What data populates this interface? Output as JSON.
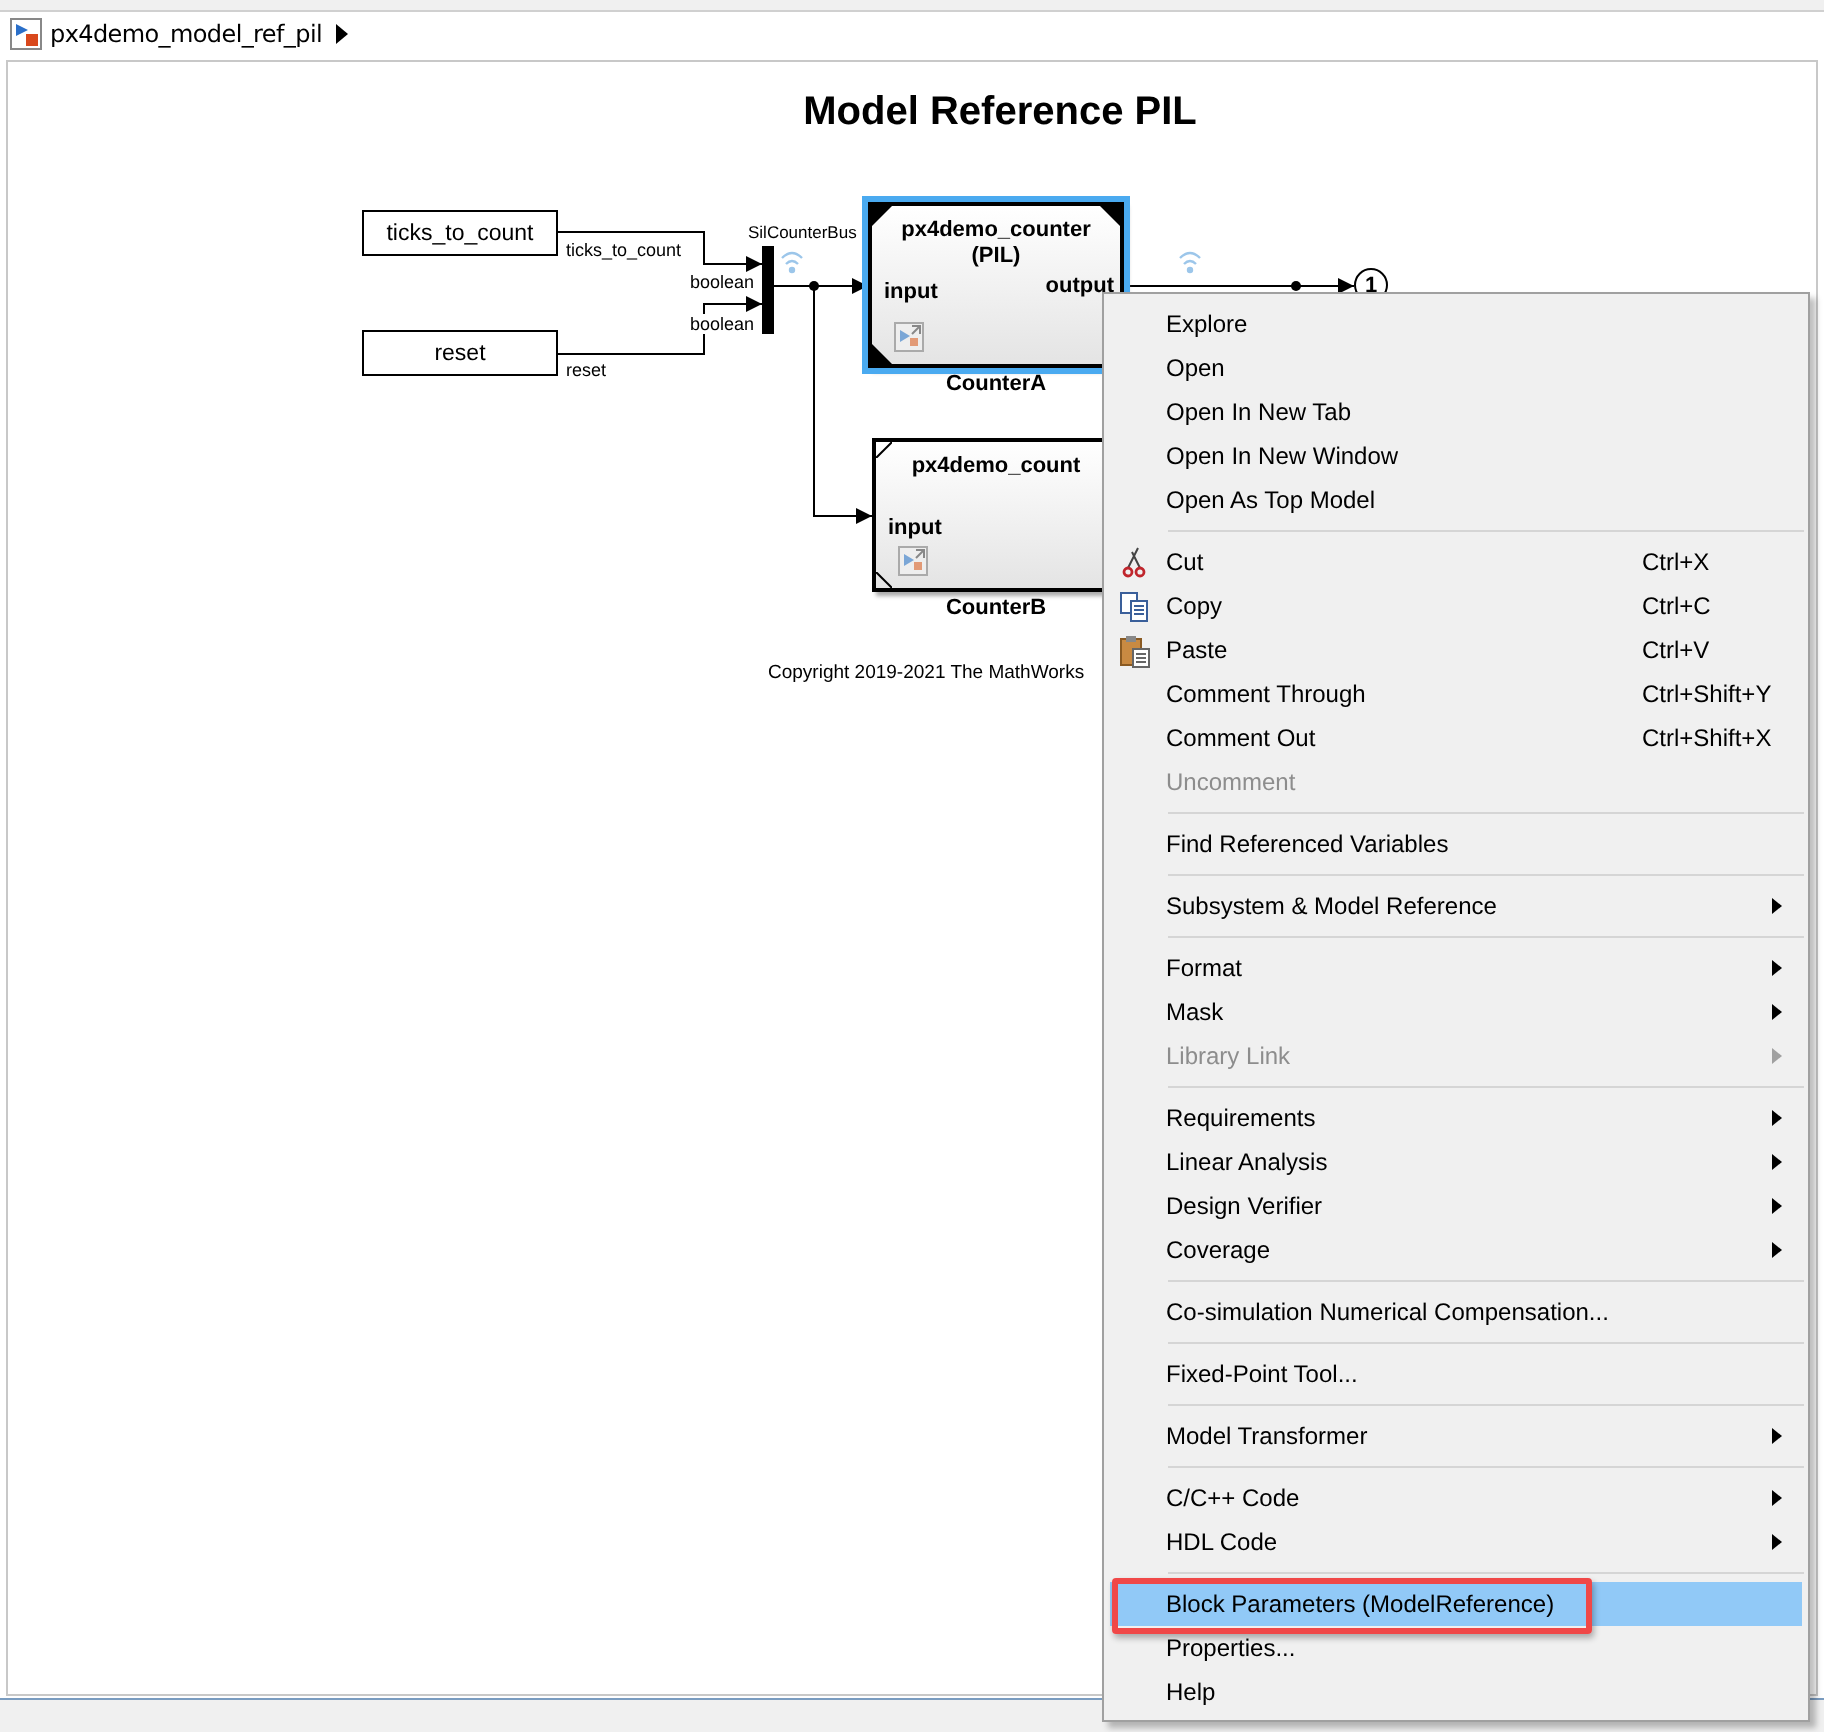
{
  "breadcrumb": {
    "model": "px4demo_model_ref_pil"
  },
  "diagram": {
    "title": "Model Reference PIL",
    "inports": [
      {
        "name": "ticks_to_count",
        "signal": "ticks_to_count",
        "type_label": "boolean"
      },
      {
        "name": "reset",
        "signal": "reset",
        "type_label": "boolean"
      }
    ],
    "bus_label": "SilCounterBus",
    "blocks": [
      {
        "model": "px4demo_counter",
        "mode": "(PIL)",
        "input": "input",
        "output": "output",
        "label": "CounterA",
        "selected": true
      },
      {
        "model": "px4demo_count",
        "input": "input",
        "label": "CounterB",
        "selected": false
      }
    ],
    "outport": "1",
    "copyright": "Copyright 2019-2021 The MathWorks"
  },
  "context_menu": [
    [
      {
        "label": "Explore",
        "kind": "plain",
        "disabled": false,
        "submenu": false,
        "selected": false,
        "outlined": false
      },
      {
        "label": "Open",
        "kind": "plain",
        "disabled": false,
        "submenu": false,
        "selected": false,
        "outlined": false
      },
      {
        "label": "Open In New Tab",
        "kind": "plain",
        "disabled": false,
        "submenu": false,
        "selected": false,
        "outlined": false
      },
      {
        "label": "Open In New Window",
        "kind": "plain",
        "disabled": false,
        "submenu": false,
        "selected": false,
        "outlined": false
      },
      {
        "label": "Open As Top Model",
        "kind": "plain",
        "disabled": false,
        "submenu": false,
        "selected": false,
        "outlined": false
      }
    ],
    [
      {
        "label": "Cut",
        "shortcut": "Ctrl+X",
        "kind": "cut",
        "disabled": false,
        "submenu": false,
        "selected": false,
        "outlined": false
      },
      {
        "label": "Copy",
        "shortcut": "Ctrl+C",
        "kind": "copy",
        "disabled": false,
        "submenu": false,
        "selected": false,
        "outlined": false
      },
      {
        "label": "Paste",
        "shortcut": "Ctrl+V",
        "kind": "paste",
        "disabled": false,
        "submenu": false,
        "selected": false,
        "outlined": false
      },
      {
        "label": "Comment Through",
        "shortcut": "Ctrl+Shift+Y",
        "kind": "plain",
        "disabled": false,
        "submenu": false,
        "selected": false,
        "outlined": false
      },
      {
        "label": "Comment Out",
        "shortcut": "Ctrl+Shift+X",
        "kind": "plain",
        "disabled": false,
        "submenu": false,
        "selected": false,
        "outlined": false
      },
      {
        "label": "Uncomment",
        "kind": "plain",
        "disabled": true,
        "submenu": false,
        "selected": false,
        "outlined": false
      }
    ],
    [
      {
        "label": "Find Referenced Variables",
        "kind": "plain",
        "disabled": false,
        "submenu": false,
        "selected": false,
        "outlined": false
      }
    ],
    [
      {
        "label": "Subsystem & Model Reference",
        "kind": "plain",
        "disabled": false,
        "submenu": true,
        "selected": false,
        "outlined": false
      }
    ],
    [
      {
        "label": "Format",
        "kind": "plain",
        "disabled": false,
        "submenu": true,
        "selected": false,
        "outlined": false
      },
      {
        "label": "Mask",
        "kind": "plain",
        "disabled": false,
        "submenu": true,
        "selected": false,
        "outlined": false
      },
      {
        "label": "Library Link",
        "kind": "plain",
        "disabled": true,
        "submenu": true,
        "selected": false,
        "outlined": false
      }
    ],
    [
      {
        "label": "Requirements",
        "kind": "plain",
        "disabled": false,
        "submenu": true,
        "selected": false,
        "outlined": false
      },
      {
        "label": "Linear Analysis",
        "kind": "plain",
        "disabled": false,
        "submenu": true,
        "selected": false,
        "outlined": false
      },
      {
        "label": "Design Verifier",
        "kind": "plain",
        "disabled": false,
        "submenu": true,
        "selected": false,
        "outlined": false
      },
      {
        "label": "Coverage",
        "kind": "plain",
        "disabled": false,
        "submenu": true,
        "selected": false,
        "outlined": false
      }
    ],
    [
      {
        "label": "Co-simulation Numerical Compensation...",
        "kind": "plain",
        "disabled": false,
        "submenu": false,
        "selected": false,
        "outlined": false
      }
    ],
    [
      {
        "label": "Fixed-Point Tool...",
        "kind": "plain",
        "disabled": false,
        "submenu": false,
        "selected": false,
        "outlined": false
      }
    ],
    [
      {
        "label": "Model Transformer",
        "kind": "plain",
        "disabled": false,
        "submenu": true,
        "selected": false,
        "outlined": false
      }
    ],
    [
      {
        "label": "C/C++ Code",
        "kind": "plain",
        "disabled": false,
        "submenu": true,
        "selected": false,
        "outlined": false
      },
      {
        "label": "HDL Code",
        "kind": "plain",
        "disabled": false,
        "submenu": true,
        "selected": false,
        "outlined": false
      }
    ],
    [
      {
        "label": "Block Parameters (ModelReference)",
        "kind": "plain",
        "disabled": false,
        "submenu": false,
        "selected": true,
        "outlined": true
      },
      {
        "label": "Properties...",
        "kind": "plain",
        "disabled": false,
        "submenu": false,
        "selected": false,
        "outlined": false
      },
      {
        "label": "Help",
        "kind": "plain",
        "disabled": false,
        "submenu": false,
        "selected": false,
        "outlined": false
      }
    ]
  ]
}
